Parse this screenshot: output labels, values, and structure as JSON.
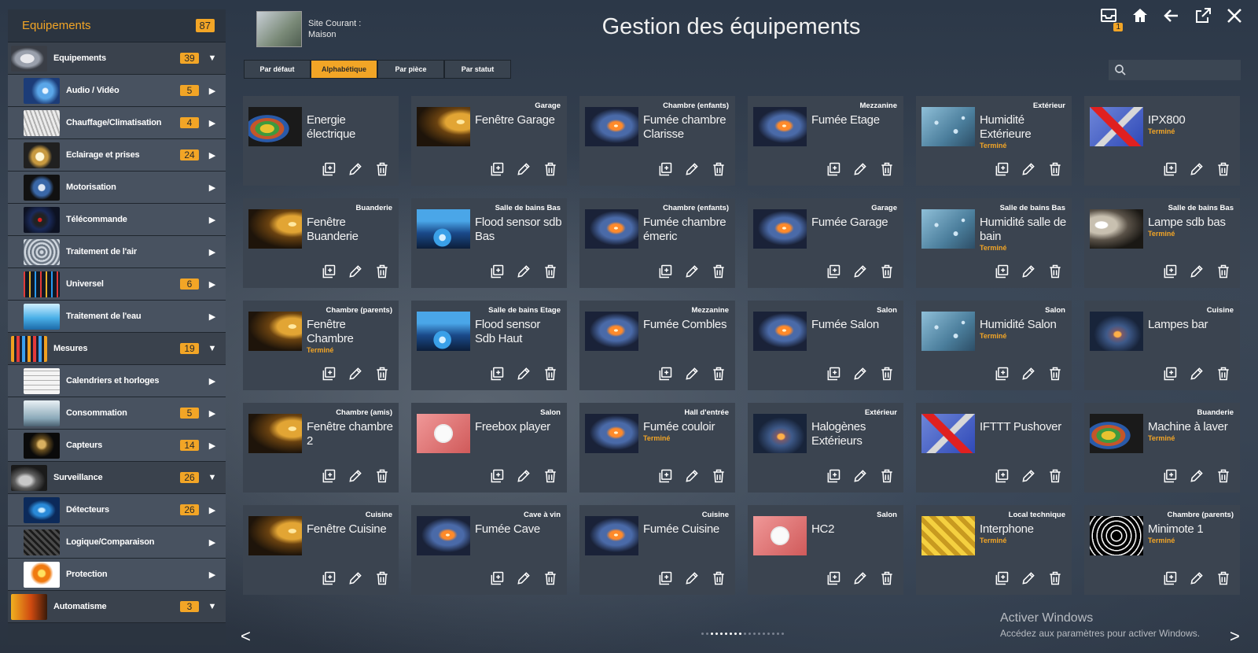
{
  "sidebar": {
    "header": {
      "title": "Equipements",
      "count": "87"
    },
    "items": [
      {
        "label": "Equipements",
        "count": "39",
        "type": "cat",
        "expanded": true,
        "thumb": "t-equip"
      },
      {
        "label": "Audio / Vidéo",
        "count": "5",
        "type": "sub",
        "thumb": "t-audio"
      },
      {
        "label": "Chauffage/Climatisation",
        "count": "4",
        "type": "sub",
        "thumb": "t-chauff"
      },
      {
        "label": "Eclairage et prises",
        "count": "24",
        "type": "sub",
        "thumb": "t-eclair"
      },
      {
        "label": "Motorisation",
        "count": "",
        "type": "sub",
        "thumb": "t-motor"
      },
      {
        "label": "Télécommande",
        "count": "",
        "type": "sub",
        "thumb": "t-tele"
      },
      {
        "label": "Traitement de l'air",
        "count": "",
        "type": "sub",
        "thumb": "t-air"
      },
      {
        "label": "Universel",
        "count": "6",
        "type": "sub",
        "thumb": "t-univ"
      },
      {
        "label": "Traitement de l'eau",
        "count": "",
        "type": "sub",
        "thumb": "t-eau"
      },
      {
        "label": "Mesures",
        "count": "19",
        "type": "cat",
        "expanded": true,
        "thumb": "t-mes"
      },
      {
        "label": "Calendriers et horloges",
        "count": "",
        "type": "sub",
        "thumb": "t-cal"
      },
      {
        "label": "Consommation",
        "count": "5",
        "type": "sub",
        "thumb": "t-conso"
      },
      {
        "label": "Capteurs",
        "count": "14",
        "type": "sub",
        "thumb": "t-capt"
      },
      {
        "label": "Surveillance",
        "count": "26",
        "type": "cat",
        "expanded": true,
        "thumb": "t-surv"
      },
      {
        "label": "Détecteurs",
        "count": "26",
        "type": "sub",
        "thumb": "t-detect"
      },
      {
        "label": "Logique/Comparaison",
        "count": "",
        "type": "sub",
        "thumb": "t-logic"
      },
      {
        "label": "Protection",
        "count": "",
        "type": "sub",
        "thumb": "t-prot"
      },
      {
        "label": "Automatisme",
        "count": "3",
        "type": "cat",
        "expanded": true,
        "thumb": "t-auto"
      }
    ]
  },
  "header": {
    "site_label": "Site Courant :",
    "site_name": "Maison",
    "title": "Gestion des équipements",
    "notification_count": "1"
  },
  "tabs": [
    {
      "label": "Par défaut",
      "active": false
    },
    {
      "label": "Alphabétique",
      "active": true
    },
    {
      "label": "Par pièce",
      "active": false
    },
    {
      "label": "Par statut",
      "active": false
    }
  ],
  "search": {
    "placeholder": ""
  },
  "cards": [
    {
      "name": "Energie électrique",
      "room": "",
      "status": "",
      "img": "im-energy"
    },
    {
      "name": "Fenêtre Garage",
      "room": "Garage",
      "status": "",
      "img": "im-window"
    },
    {
      "name": "Fumée chambre Clarisse",
      "room": "Chambre (enfants)",
      "status": "",
      "img": "im-smoke"
    },
    {
      "name": "Fumée Etage",
      "room": "Mezzanine",
      "status": "",
      "img": "im-smoke"
    },
    {
      "name": "Humidité Extérieure",
      "room": "Extérieur",
      "status": "Terminé",
      "img": "im-humid"
    },
    {
      "name": "IPX800",
      "room": "",
      "status": "Terminé",
      "img": "im-ipx"
    },
    {
      "name": "Fenêtre Buanderie",
      "room": "Buanderie",
      "status": "",
      "img": "im-window"
    },
    {
      "name": "Flood sensor sdb Bas",
      "room": "Salle de bains Bas",
      "status": "",
      "img": "im-flood"
    },
    {
      "name": "Fumée chambre émeric",
      "room": "Chambre (enfants)",
      "status": "",
      "img": "im-smoke"
    },
    {
      "name": "Fumée Garage",
      "room": "Garage",
      "status": "",
      "img": "im-smoke"
    },
    {
      "name": "Humidité salle de bain",
      "room": "Salle de bains Bas",
      "status": "Terminé",
      "img": "im-humid"
    },
    {
      "name": "Lampe sdb bas",
      "room": "Salle de bains Bas",
      "status": "Terminé",
      "img": "im-lamp"
    },
    {
      "name": "Fenêtre Chambre",
      "room": "Chambre (parents)",
      "status": "Terminé",
      "img": "im-window"
    },
    {
      "name": "Flood sensor Sdb Haut",
      "room": "Salle de bains Etage",
      "status": "",
      "img": "im-flood"
    },
    {
      "name": "Fumée Combles",
      "room": "Mezzanine",
      "status": "",
      "img": "im-smoke"
    },
    {
      "name": "Fumée Salon",
      "room": "Salon",
      "status": "",
      "img": "im-smoke"
    },
    {
      "name": "Humidité Salon",
      "room": "Salon",
      "status": "Terminé",
      "img": "im-humid"
    },
    {
      "name": "Lampes bar",
      "room": "Cuisine",
      "status": "",
      "img": "im-bulb"
    },
    {
      "name": "Fenêtre chambre 2",
      "room": "Chambre (amis)",
      "status": "",
      "img": "im-window"
    },
    {
      "name": "Freebox player",
      "room": "Salon",
      "status": "",
      "img": "im-plug"
    },
    {
      "name": "Fumée couloir",
      "room": "Hall d'entrée",
      "status": "Terminé",
      "img": "im-smoke"
    },
    {
      "name": "Halogènes Extérieurs",
      "room": "Extérieur",
      "status": "",
      "img": "im-bulb"
    },
    {
      "name": "IFTTT Pushover",
      "room": "",
      "status": "",
      "img": "im-ipx"
    },
    {
      "name": "Machine à laver",
      "room": "Buanderie",
      "status": "Terminé",
      "img": "im-energy"
    },
    {
      "name": "Fenêtre Cuisine",
      "room": "Cuisine",
      "status": "",
      "img": "im-window"
    },
    {
      "name": "Fumée Cave",
      "room": "Cave à vin",
      "status": "",
      "img": "im-smoke"
    },
    {
      "name": "Fumée Cuisine",
      "room": "Cuisine",
      "status": "",
      "img": "im-smoke"
    },
    {
      "name": "HC2",
      "room": "Salon",
      "status": "",
      "img": "im-plug"
    },
    {
      "name": "Interphone",
      "room": "Local technique",
      "status": "Terminé",
      "img": "im-inter"
    },
    {
      "name": "Minimote 1",
      "room": "Chambre (parents)",
      "status": "Terminé",
      "img": "im-mini"
    }
  ],
  "pager": {
    "prev": "<",
    "next": ">",
    "total_dots": 18,
    "active_start": 2,
    "active_end": 8
  },
  "watermark": {
    "title": "Activer Windows",
    "subtitle": "Accédez aux paramètres pour activer Windows."
  },
  "colors": {
    "accent": "#f2a526",
    "card_bg": "#3b4450",
    "sidebar_bg": "#2b3440"
  }
}
